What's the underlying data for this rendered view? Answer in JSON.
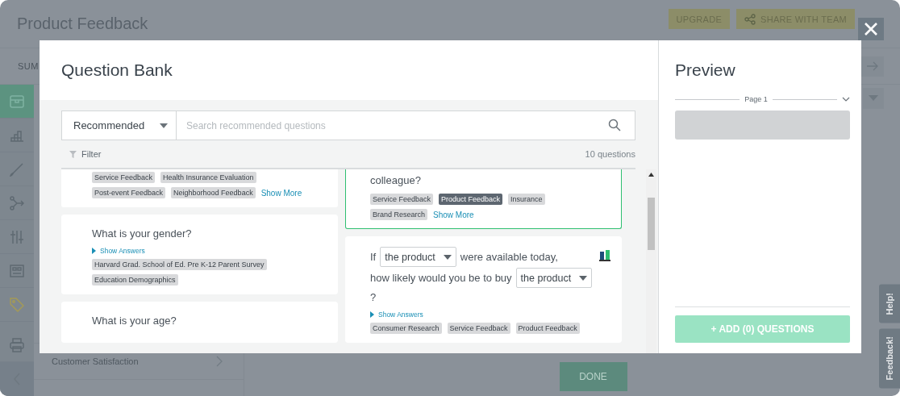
{
  "page": {
    "title": "Product Feedback",
    "buttons": [
      {
        "kind": "upgrade",
        "label": "UPGRADE"
      },
      {
        "kind": "share",
        "label": "SHARE WITH TEAM"
      }
    ],
    "tab": "SUM",
    "sidebar": {
      "items": [
        {
          "kind": "survey",
          "selected": true
        },
        {
          "kind": "analyze",
          "selected": false
        },
        {
          "kind": "design",
          "selected": false
        },
        {
          "kind": "logic",
          "selected": false
        },
        {
          "kind": "options",
          "selected": false
        },
        {
          "kind": "layout",
          "selected": false
        },
        {
          "kind": "tag",
          "selected": false
        }
      ],
      "bottom_items": [
        {
          "kind": "print"
        },
        {
          "kind": "collapse"
        }
      ]
    },
    "panel_row": "Customer Satisfaction",
    "done_button": "DONE",
    "side_tabs": [
      "Help!",
      "Feedback!"
    ]
  },
  "modal": {
    "title": "Question Bank",
    "source": "Recommended",
    "search": {
      "placeholder": "Search recommended questions"
    },
    "filter": "Filter",
    "count": "10 questions",
    "columns": [
      [
        {
          "selected": false,
          "tags": [
            {
              "label": "Service Feedback",
              "highlighted": false
            },
            {
              "label": "Health Insurance Evaluation",
              "highlighted": false
            },
            {
              "label": "Post-event Feedback",
              "highlighted": false
            },
            {
              "label": "Neighborhood Feedback",
              "highlighted": false
            }
          ],
          "show_more": "Show More"
        },
        {
          "selected": false,
          "segments": [
            {
              "kind": "text",
              "text": "What is your gender?"
            }
          ],
          "show_answers": "Show Answers",
          "tags": [
            {
              "label": "Harvard Grad. School of Ed. Pre K-12 Parent Survey",
              "highlighted": false
            },
            {
              "label": "Education Demographics",
              "highlighted": false
            }
          ]
        },
        {
          "selected": false,
          "segments": [
            {
              "kind": "text",
              "text": "What is your age?"
            }
          ]
        }
      ],
      [
        {
          "selected": true,
          "segments": [
            {
              "kind": "text",
              "text": "colleague?"
            }
          ],
          "tags": [
            {
              "label": "Service Feedback",
              "highlighted": false
            },
            {
              "label": "Product Feedback",
              "highlighted": true
            },
            {
              "label": "Insurance",
              "highlighted": false
            },
            {
              "label": "Brand Research",
              "highlighted": false
            }
          ],
          "show_more": "Show More"
        },
        {
          "selected": false,
          "segments": [
            {
              "kind": "text",
              "text": "If"
            },
            {
              "kind": "select",
              "text": "the product"
            },
            {
              "kind": "text",
              "text": "were available today,"
            },
            {
              "kind": "text",
              "text": "how likely would you be to buy"
            },
            {
              "kind": "select",
              "text": "the product"
            },
            {
              "kind": "text",
              "text": "?"
            }
          ],
          "show_answers": "Show Answers",
          "tags": [
            {
              "label": "Consumer Research",
              "highlighted": false
            },
            {
              "label": "Service Feedback",
              "highlighted": false
            },
            {
              "label": "Product Feedback",
              "highlighted": false
            }
          ],
          "chart_icon": true
        }
      ]
    ],
    "preview": {
      "title": "Preview",
      "page": "Page 1",
      "add_button": "+ ADD (0) QUESTIONS",
      "add_disabled": true
    }
  }
}
